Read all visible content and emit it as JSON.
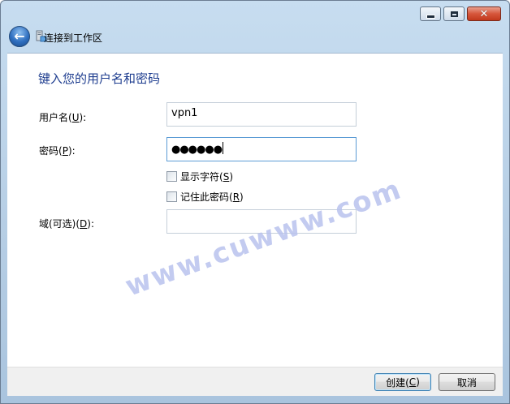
{
  "window": {
    "title": "连接到工作区",
    "controls": {
      "minimize_icon": "minimize-icon",
      "maximize_icon": "maximize-icon",
      "close_icon": "close-icon"
    }
  },
  "navigation": {
    "back_icon": "back-arrow-icon"
  },
  "main": {
    "heading": "键入您的用户名和密码",
    "username": {
      "label": "用户名(",
      "mnemonic": "U",
      "label_end": "):",
      "value": "vpn1"
    },
    "password": {
      "label": "密码(",
      "mnemonic": "P",
      "label_end": "):",
      "value": "●●●●●●"
    },
    "show_chars": {
      "label": "显示字符(",
      "mnemonic": "S",
      "label_end": ")",
      "checked": false
    },
    "remember": {
      "label": "记住此密码(",
      "mnemonic": "R",
      "label_end": ")",
      "checked": false
    },
    "domain": {
      "label": "域(可选)(",
      "mnemonic": "D",
      "label_end": "):",
      "value": ""
    }
  },
  "watermark": "www.cuwww.com",
  "footer": {
    "create": {
      "label": "创建(",
      "mnemonic": "C",
      "label_end": ")"
    },
    "cancel": {
      "label": "取消"
    }
  },
  "colors": {
    "heading": "#1e3d8f",
    "frame": "#b5cde4",
    "focus_border": "#5b9bd5",
    "close_button": "#c2391c"
  }
}
